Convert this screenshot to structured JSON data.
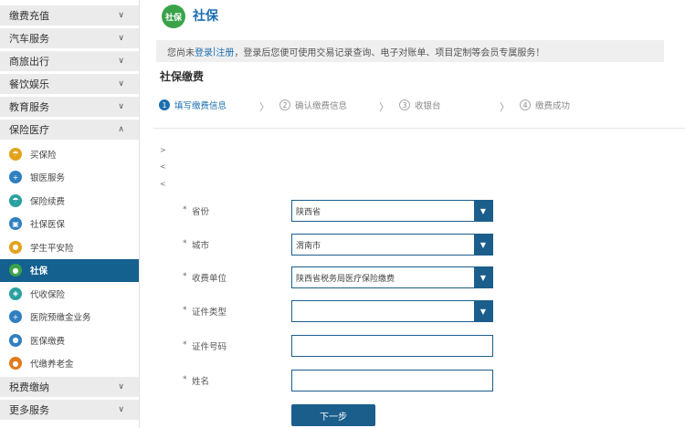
{
  "sidebar": {
    "categories_top": [
      {
        "label": "缴费充值"
      },
      {
        "label": "汽车服务"
      },
      {
        "label": "商旅出行"
      },
      {
        "label": "餐饮娱乐"
      },
      {
        "label": "教育服务"
      }
    ],
    "open_category": {
      "label": "保险医疗"
    },
    "subitems": [
      {
        "label": "买保险",
        "icon": "umbrella-icon",
        "color": "#e3a21a"
      },
      {
        "label": "银医服务",
        "icon": "hospital-icon",
        "color": "#2f7fc1"
      },
      {
        "label": "保险续费",
        "icon": "umbrella-icon",
        "color": "#2aa0a0"
      },
      {
        "label": "社保医保",
        "icon": "card-icon",
        "color": "#2f7fc1"
      },
      {
        "label": "学生平安险",
        "icon": "student-icon",
        "color": "#e3a21a"
      },
      {
        "label": "社保",
        "icon": "social-security-icon",
        "color": "#3aa34a",
        "active": true
      },
      {
        "label": "代收保险",
        "icon": "shield-icon",
        "color": "#2aa0a0"
      },
      {
        "label": "医院预缴金业务",
        "icon": "hospital-icon",
        "color": "#2f7fc1"
      },
      {
        "label": "医保缴费",
        "icon": "medical-icon",
        "color": "#2f7fc1"
      },
      {
        "label": "代缴养老金",
        "icon": "pension-icon",
        "color": "#e07a1a"
      }
    ],
    "categories_bottom": [
      {
        "label": "税费缴纳"
      },
      {
        "label": "更多服务"
      }
    ]
  },
  "header": {
    "title": "社保",
    "logo_text": "社保"
  },
  "notice": {
    "prefix": "您尚未",
    "login": "登录",
    "sep": "|",
    "register": "注册",
    "suffix": "，登录后您便可使用交易记录查询、电子对账单、项目定制等会员专属服务！"
  },
  "section_title": "社保缴费",
  "steps": [
    {
      "num": "1",
      "label": "填写缴费信息",
      "active": true
    },
    {
      "num": "2",
      "label": "确认缴费信息"
    },
    {
      "num": "3",
      "label": "收银台"
    },
    {
      "num": "4",
      "label": "缴费成功"
    }
  ],
  "step_arrow": "〉",
  "tiny_marks": [
    ">",
    "<",
    "<"
  ],
  "form": {
    "star": "*",
    "fields": [
      {
        "label": "省份",
        "value": "陕西省",
        "type": "select"
      },
      {
        "label": "城市",
        "value": "渭南市",
        "type": "select"
      },
      {
        "label": "收费单位",
        "value": "陕西省税务局医疗保险缴费",
        "type": "select"
      },
      {
        "label": "证件类型",
        "value": "",
        "type": "select"
      },
      {
        "label": "证件号码",
        "value": "",
        "type": "input"
      },
      {
        "label": "姓名",
        "value": "",
        "type": "input"
      }
    ],
    "next_button": "下一步"
  },
  "colors": {
    "brand_blue": "#1b5e8c",
    "link_blue": "#1b6fb0",
    "active_bg": "#14618f"
  }
}
